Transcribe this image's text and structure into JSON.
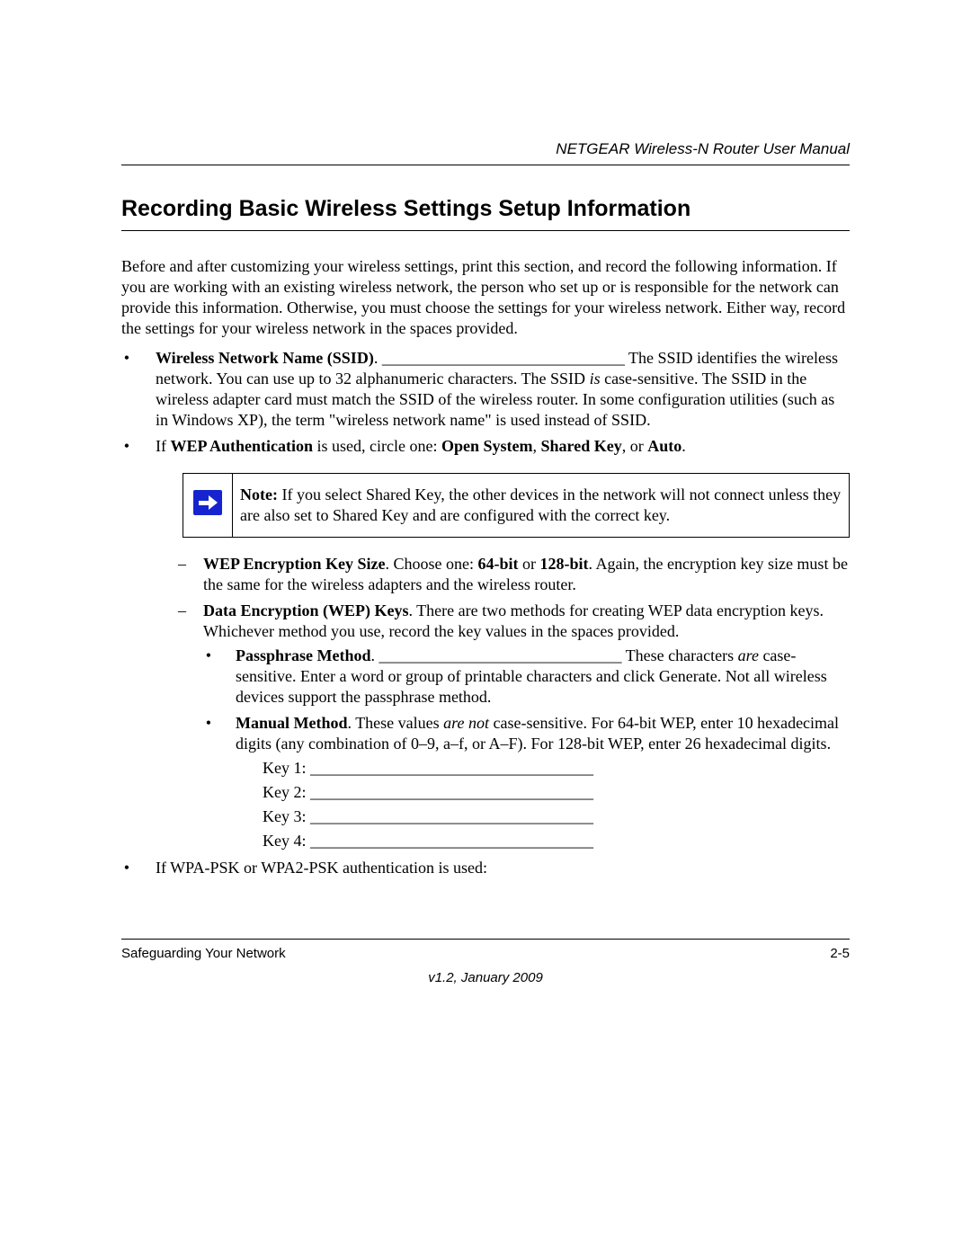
{
  "header": {
    "title": "NETGEAR Wireless-N Router User Manual"
  },
  "section_title": "Recording Basic Wireless Settings Setup Information",
  "intro": "Before and after customizing your wireless settings, print this section, and record the following information. If you are working with an existing wireless network, the person who set up or is responsible for the network can provide this information. Otherwise, you must choose the settings for your wireless network. Either way, record the settings for your wireless network in the spaces provided.",
  "ssid": {
    "label": "Wireless Network Name (SSID)",
    "blank": "______________________________",
    "tail": "The SSID identifies the wireless network. You can use up to 32 alphanumeric characters. The SSID ",
    "is": "is",
    "tail2": " case-sensitive. The SSID in the wireless adapter card must match the SSID of the wireless router. In some configuration utilities (such as in Windows XP), the term \"wireless network name\" is used instead of SSID."
  },
  "wep_auth": {
    "prefix": "If ",
    "label": "WEP Authentication",
    "mid": " is used, circle one: ",
    "opts": [
      "Open System",
      "Shared Key",
      "Auto"
    ]
  },
  "note": {
    "label": "Note:",
    "text": " If you select Shared Key, the other devices in the network will not connect unless they are also set to Shared Key and are configured with the correct key."
  },
  "wep_size": {
    "label": "WEP Encryption Key Size",
    "mid": ". Choose one: ",
    "o1": "64-bit",
    "or": " or ",
    "o2": "128-bit",
    "tail": ". Again, the encryption key size must be the same for the wireless adapters and the wireless router."
  },
  "wep_keys": {
    "label": "Data Encryption (WEP) Keys",
    "tail": ". There are two methods for creating WEP data encryption keys. Whichever method you use, record the key values in the spaces provided."
  },
  "pass": {
    "label": "Passphrase Method",
    "blank": "______________________________",
    "tail1": " These characters ",
    "are": "are",
    "tail2": " case-sensitive. Enter a word or group of printable characters and click Generate. Not all wireless devices support the passphrase method."
  },
  "manual": {
    "label": "Manual Method",
    "pre": ". These values ",
    "arenot": "are not",
    "tail": " case-sensitive. For 64-bit WEP, enter 10 hexadecimal digits (any combination of 0–9, a–f, or A–F). For 128-bit WEP, enter 26 hexadecimal digits."
  },
  "keys": {
    "k1": "Key 1: ___________________________________",
    "k2": "Key 2: ___________________________________",
    "k3": "Key 3: ___________________________________",
    "k4": "Key 4: ___________________________________"
  },
  "wpa_line": "If WPA-PSK or WPA2-PSK authentication is used:",
  "footer": {
    "left": "Safeguarding Your Network",
    "right": "2-5",
    "version": "v1.2, January 2009"
  }
}
